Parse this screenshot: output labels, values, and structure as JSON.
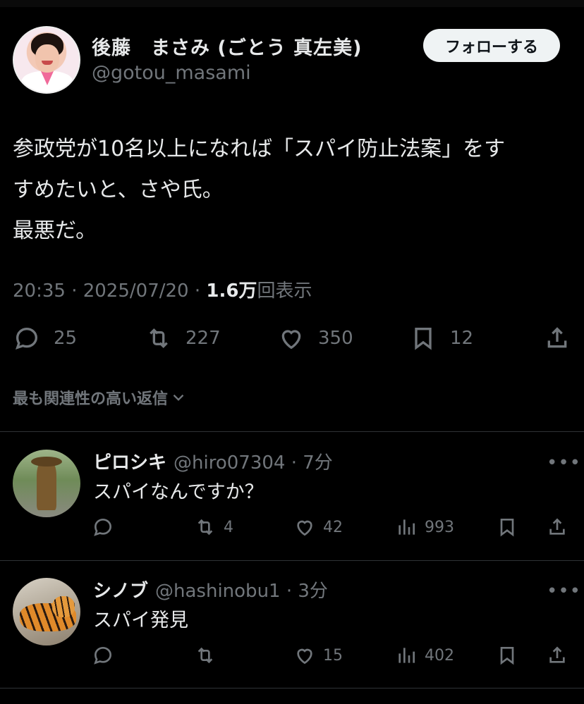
{
  "tweet": {
    "display_name": "後藤　まさみ (ごとう 真左美)",
    "handle": "@gotou_masami",
    "follow_label": "フォローする",
    "text": "参政党が10名以上になれば「スパイ防止法案」をす\nすめたいと、さや氏。\n最悪だ。",
    "time": "20:35 · 2025/07/20 · ",
    "views_count": "1.6万",
    "views_label": "回表示",
    "replies": "25",
    "reposts": "227",
    "likes": "350",
    "bookmarks": "12"
  },
  "replies_filter": {
    "label": "最も関連性の高い返信"
  },
  "replies": [
    {
      "name": "ピロシキ",
      "handle": "@hiro07304",
      "time": "· 7分",
      "text": "スパイなんですか？",
      "reposts": "4",
      "likes": "42",
      "views": "993"
    },
    {
      "name": "シノブ",
      "handle": "@hashinobu1",
      "time": "· 3分",
      "text": "スパイ発見",
      "reposts": "",
      "likes": "15",
      "views": "402"
    }
  ],
  "colors": {
    "background": "#000000",
    "text": "#e7e9ea",
    "muted": "#71767b",
    "divider": "#2f3336"
  }
}
